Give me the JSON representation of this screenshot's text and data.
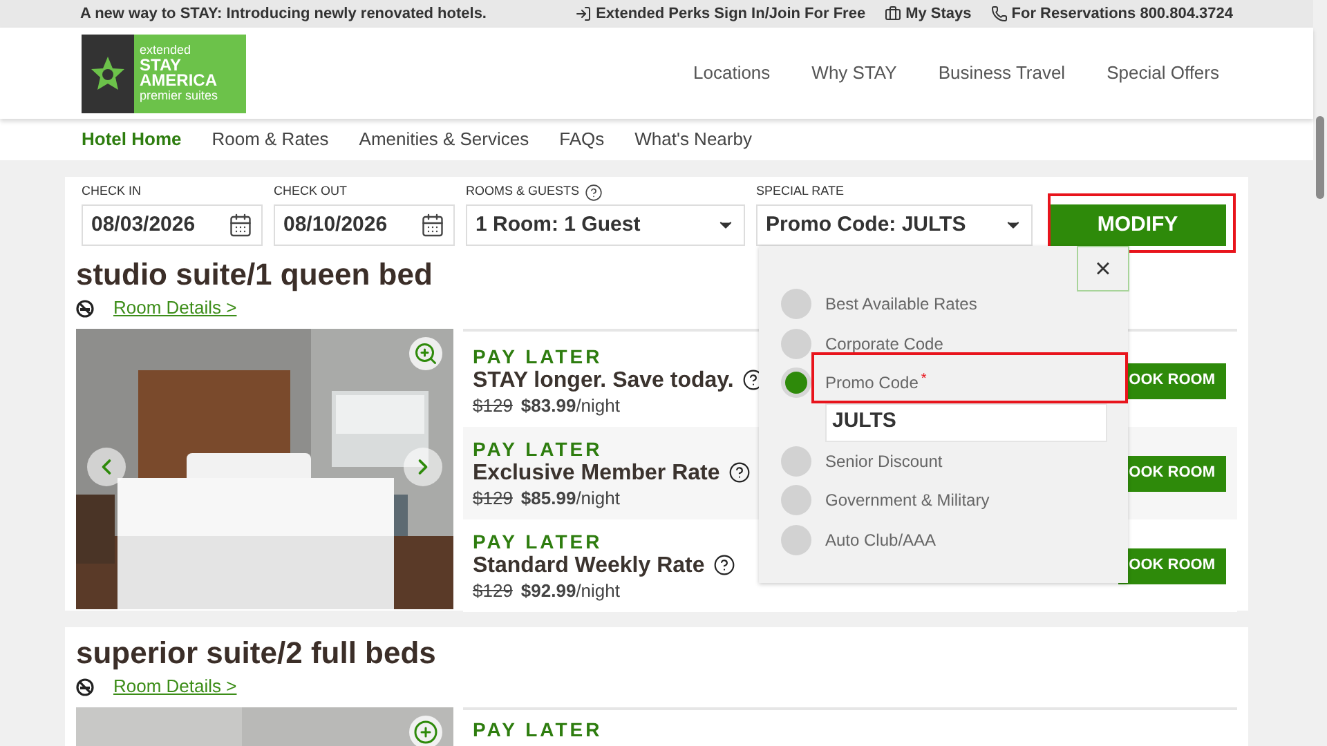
{
  "top_bar": {
    "announcement": "A new way to STAY: Introducing newly renovated hotels.",
    "links": [
      {
        "kind": "signin",
        "label": "Extended Perks Sign In/Join For Free"
      },
      {
        "kind": "stays",
        "label": "My Stays"
      },
      {
        "kind": "phone",
        "label": "For Reservations 800.804.3724"
      }
    ]
  },
  "header": {
    "logo": {
      "lines": [
        "extended",
        "STAY",
        "AMERICA",
        "premier suites"
      ]
    },
    "nav": [
      "Locations",
      "Why STAY",
      "Business Travel",
      "Special Offers"
    ]
  },
  "subnav": [
    {
      "label": "Hotel Home",
      "selected": true
    },
    {
      "label": "Room & Rates",
      "selected": false
    },
    {
      "label": "Amenities & Services",
      "selected": false
    },
    {
      "label": "FAQs",
      "selected": false
    },
    {
      "label": "What's Nearby",
      "selected": false
    }
  ],
  "booking": {
    "check_in": {
      "label": "CHECK IN",
      "value": "08/03/2026"
    },
    "check_out": {
      "label": "CHECK OUT",
      "value": "08/10/2026"
    },
    "rooms_guests": {
      "label": "ROOMS & GUESTS",
      "value": "1 Room: 1 Guest"
    },
    "special_rate": {
      "label": "SPECIAL RATE",
      "value": "Promo Code: JULTS"
    },
    "modify_button": "MODIFY"
  },
  "rate_menu": {
    "close": "×",
    "options": [
      {
        "label": "Best Available Rates",
        "selected": false
      },
      {
        "label": "Corporate Code",
        "selected": false
      },
      {
        "label": "Promo Code",
        "selected": true,
        "required_mark": "*"
      },
      {
        "label": "Senior Discount",
        "selected": false
      },
      {
        "label": "Government & Military",
        "selected": false
      },
      {
        "label": "Auto Club/AAA",
        "selected": false
      }
    ],
    "promo_value": "JULTS"
  },
  "rooms": [
    {
      "title": "studio suite/1 queen bed",
      "details_link": "Room Details >",
      "rates": [
        {
          "tag": "PAY LATER",
          "name": "STAY longer. Save today.",
          "old_price": "$129",
          "price": "$83.99",
          "unit": "/night",
          "book_button": "OOK ROOM"
        },
        {
          "tag": "PAY LATER",
          "name": "Exclusive Member Rate",
          "old_price": "$129",
          "price": "$85.99",
          "unit": "/night",
          "book_button": "OOK ROOM"
        },
        {
          "tag": "PAY LATER",
          "name": "Standard Weekly Rate",
          "old_price": "$129",
          "price": "$92.99",
          "unit": "/night",
          "book_button": "OOK ROOM"
        }
      ]
    },
    {
      "title": "superior suite/2 full beds",
      "details_link": "Room Details >",
      "rates": [
        {
          "tag": "PAY LATER"
        }
      ]
    }
  ]
}
